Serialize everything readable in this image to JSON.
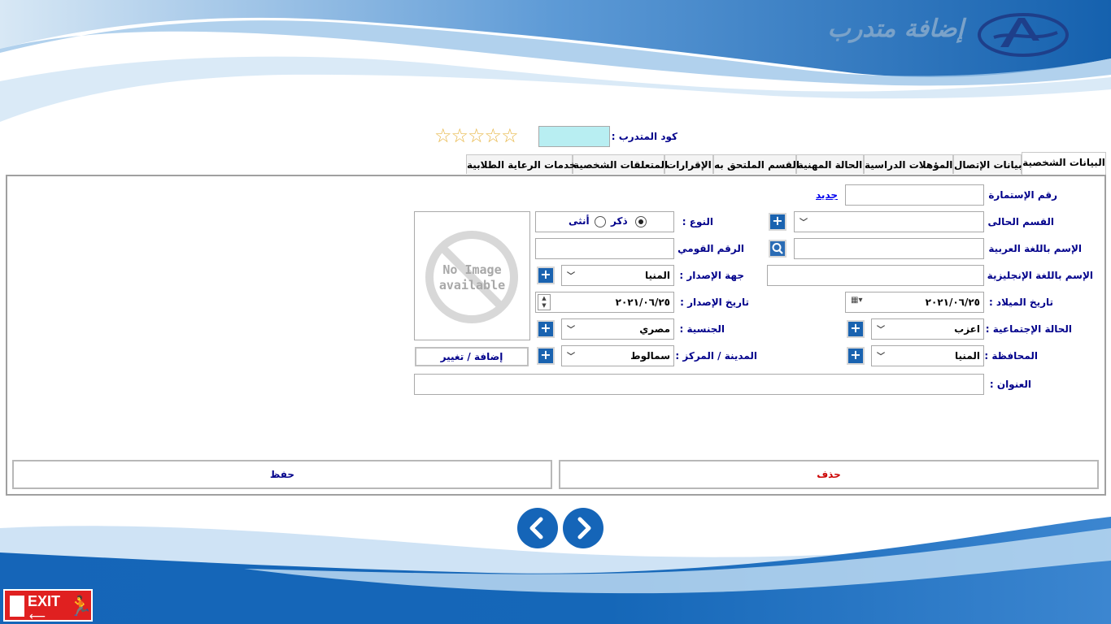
{
  "header": {
    "title": "إضافة متدرب"
  },
  "trainer_code": {
    "label": "كود المتدرب :",
    "value": "",
    "rating": 0,
    "rating_max": 5
  },
  "tabs": [
    {
      "label": "البيانات الشخصية",
      "active": true
    },
    {
      "label": "بيانات الإتصال"
    },
    {
      "label": "المؤهلات الدراسية"
    },
    {
      "label": "الحالة المهنية"
    },
    {
      "label": "القسم الملتحق به"
    },
    {
      "label": "الإقرارات"
    },
    {
      "label": "المتعلقات الشخصية"
    },
    {
      "label": "خدمات الرعاية الطلابية"
    }
  ],
  "form": {
    "form_number": {
      "label": "رقم الإستمارة :",
      "value": "",
      "new_link": "جديد"
    },
    "current_department": {
      "label": "القسم الحالى :",
      "value": ""
    },
    "arabic_name": {
      "label": "الإسم باللغة العربية :",
      "value": ""
    },
    "english_name": {
      "label": "الإسم باللغة الإنجليزية :",
      "value": ""
    },
    "birth_date": {
      "label": "تاريخ الميلاد :",
      "value": "٢٠٢١/٠٦/٢٥"
    },
    "marital_status": {
      "label": "الحالة الإجتماعية :",
      "value": "اعزب"
    },
    "governorate": {
      "label": "المحافظة :",
      "value": "المنيا"
    },
    "address": {
      "label": "العنوان :",
      "value": ""
    },
    "gender": {
      "label": "النوع :",
      "male": "ذكر",
      "female": "أنثى",
      "selected": "male"
    },
    "national_id": {
      "label": "الرقم القومي :",
      "value": ""
    },
    "issuer": {
      "label": "جهة الإصدار :",
      "value": "المنيا"
    },
    "issue_date": {
      "label": "تاريخ الإصدار :",
      "value": "٢٠٢١/٠٦/٢٥"
    },
    "nationality": {
      "label": "الجنسية :",
      "value": "مصري"
    },
    "city": {
      "label": "المدينة / المركز :",
      "value": "سمالوط"
    },
    "photo": {
      "placeholder_line1": "No Image",
      "placeholder_line2": "available",
      "change_button": "إضافة / تغيير"
    }
  },
  "actions": {
    "delete": "حذف",
    "save": "حفظ"
  },
  "exit": {
    "label": "EXIT"
  },
  "colors": {
    "accent": "#1565b8",
    "delete_text": "#cc0000",
    "label_text": "#00008b",
    "code_field": "#b8eef2"
  }
}
